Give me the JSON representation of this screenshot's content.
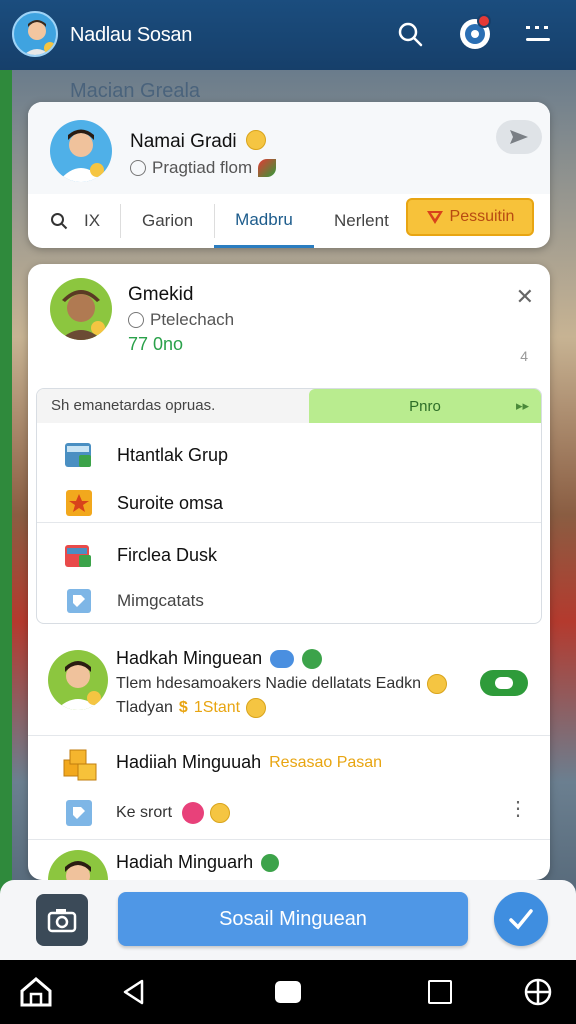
{
  "appbar": {
    "title": "Nadlau Sosan",
    "background_title": "Macian Greala",
    "icons": [
      "avatar",
      "search-icon",
      "settings-icon",
      "menu-icon"
    ]
  },
  "profile_card": {
    "name": "Namai Gradi",
    "subtitle": "Pragtiad flom",
    "tabs": [
      {
        "label": "IX",
        "icon": "search-icon"
      },
      {
        "label": "Garion"
      },
      {
        "label": "Madbru",
        "active": true
      },
      {
        "label": "Nerlent"
      }
    ],
    "premium_label": "Pessuitin"
  },
  "detail_card": {
    "name": "Gmekid",
    "subtitle": "Ptelechach",
    "count": "77 0no",
    "mini": "4",
    "options_header": "Sh emanetardas opruas.",
    "pro_label": "Pnro",
    "options": [
      {
        "label": "Htantlak Grup",
        "icon": "group-icon"
      },
      {
        "label": "Suroite omsa",
        "icon": "star-icon"
      },
      {
        "label": "Firclea Dusk",
        "icon": "desk-icon"
      },
      {
        "label": "Mimgcatats",
        "icon": "tag-icon"
      }
    ],
    "rows": [
      {
        "title": "Hadkah Minguean",
        "line1": "Tlem hdesamoakers Nadie dellatats Eadkn",
        "line2": "Tladyan",
        "line2_tag": "1Stant"
      },
      {
        "title": "Hadiiah Minguuah",
        "title_tag": "Resasao Pasan",
        "line1": "Ke srort"
      },
      {
        "title": "Hadiah Minguarh"
      }
    ]
  },
  "actionbar": {
    "main_label": "Sosail Minguean"
  },
  "colors": {
    "appbar": "#1b4d7e",
    "accent": "#4f97e6",
    "premium": "#f7c23a",
    "pro": "#b9ec8f",
    "green": "#2e9b3a"
  }
}
